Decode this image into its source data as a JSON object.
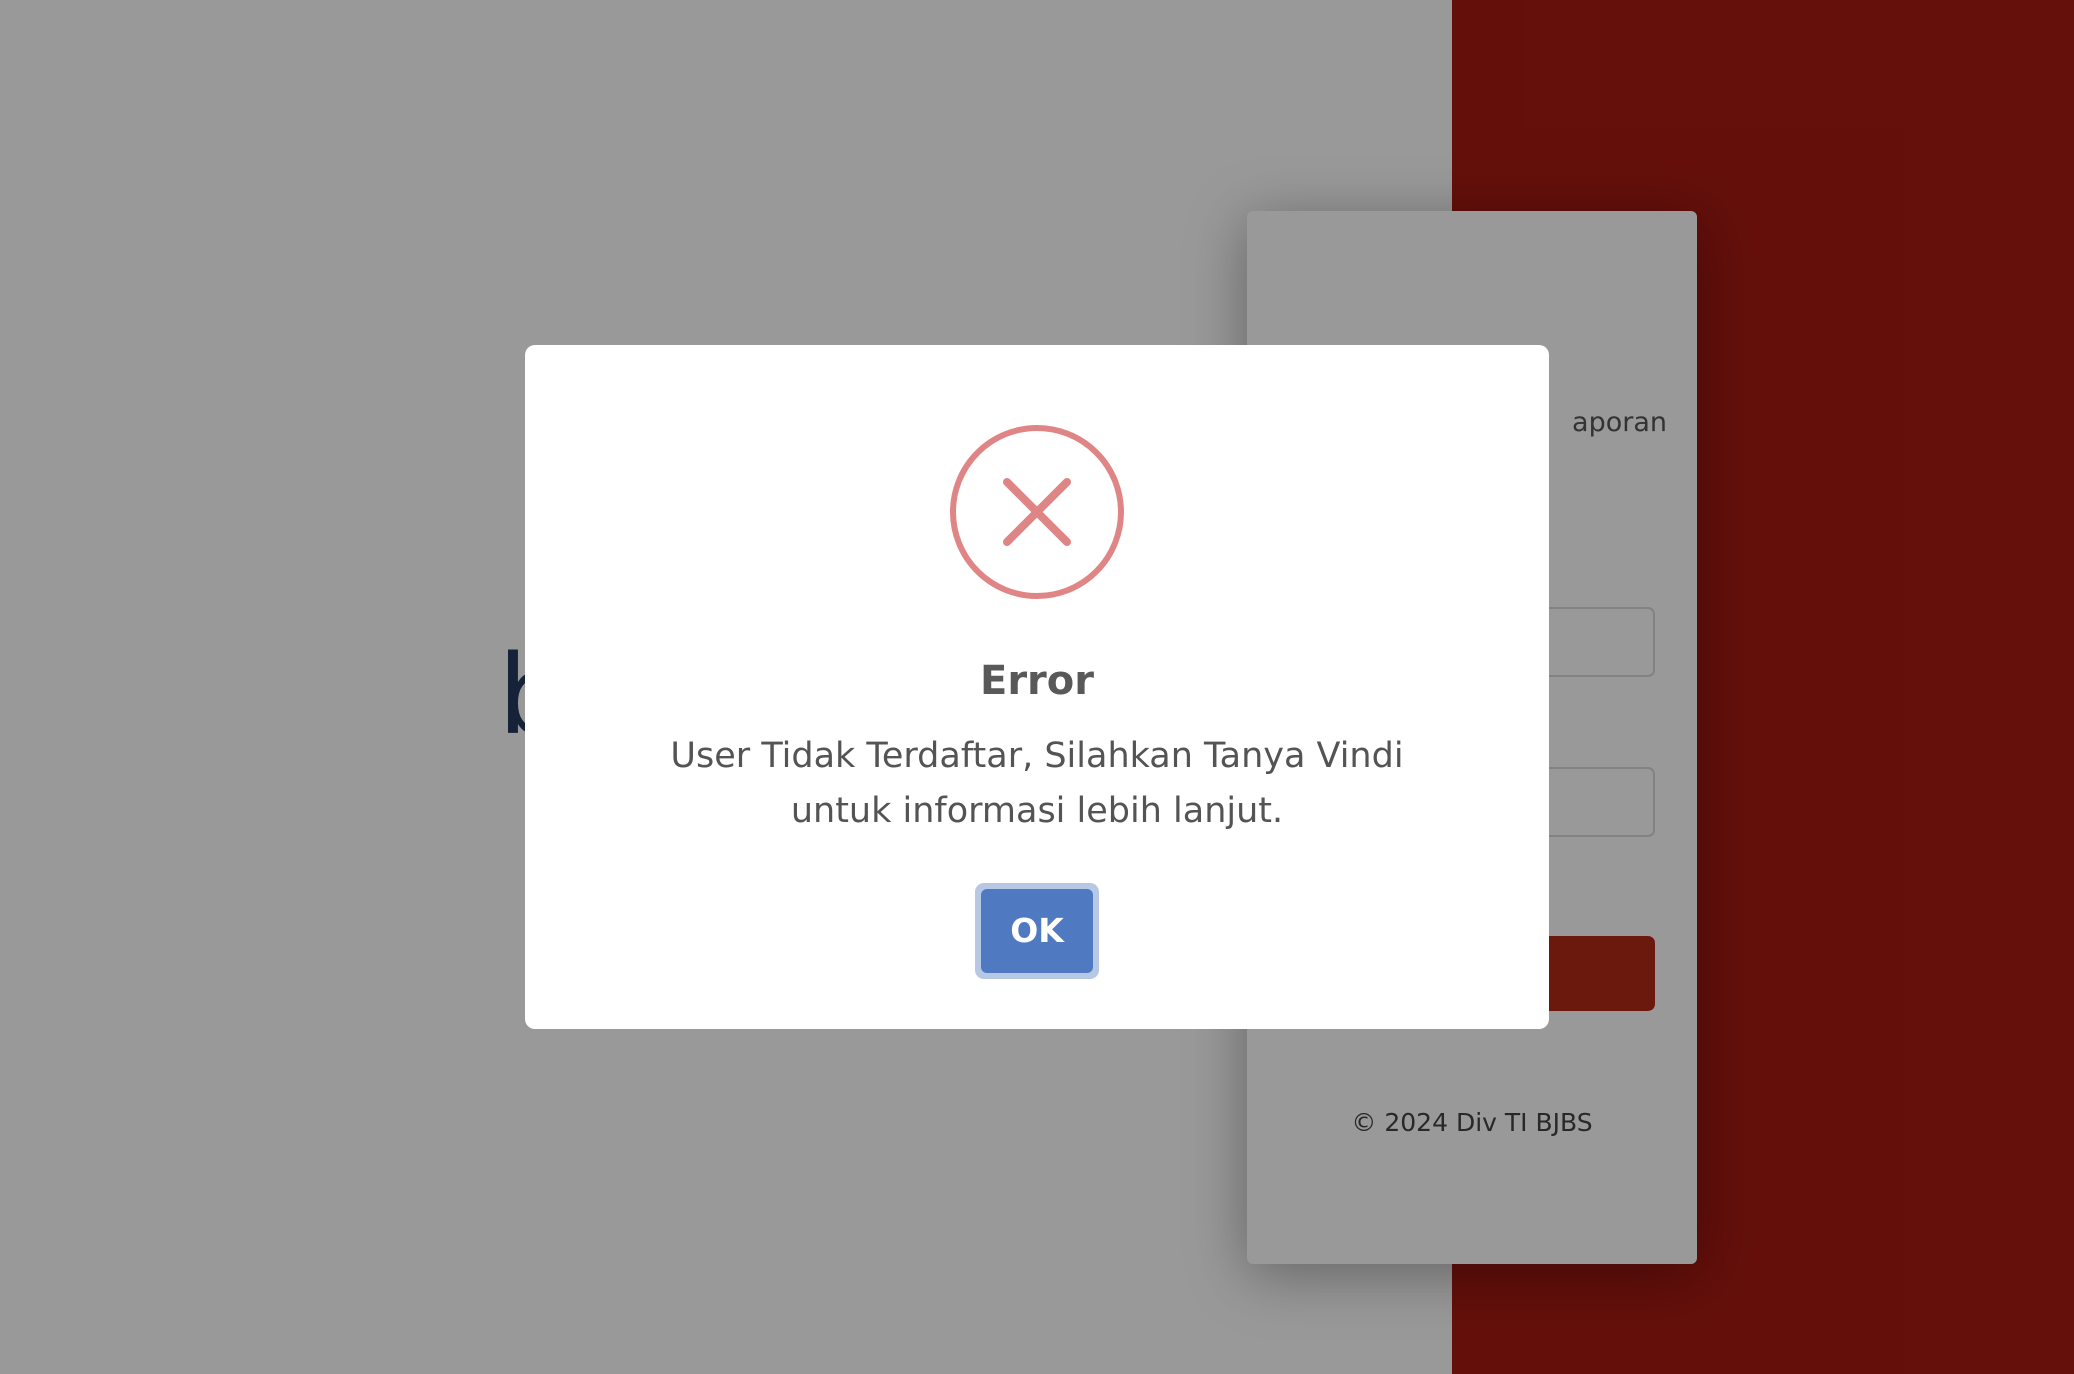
{
  "background": {
    "brand_text_fragment": "b",
    "login_card": {
      "subtitle_fragment": "aporan",
      "footer": "© 2024 Div TI BJBS"
    }
  },
  "dialog": {
    "icon": "error-x-circle-icon",
    "title": "Error",
    "message_line1": "User Tidak Terdaftar, Silahkan Tanya Vindi",
    "message_line2": "untuk informasi lebih lanjut.",
    "ok_label": "OK"
  },
  "colors": {
    "left_background": "#ffffff",
    "right_background": "#a81a12",
    "overlay": "rgba(0,0,0,0.4)",
    "error_icon": "#e08585",
    "ok_button": "#4f7ac2",
    "login_button": "#b32a14"
  }
}
